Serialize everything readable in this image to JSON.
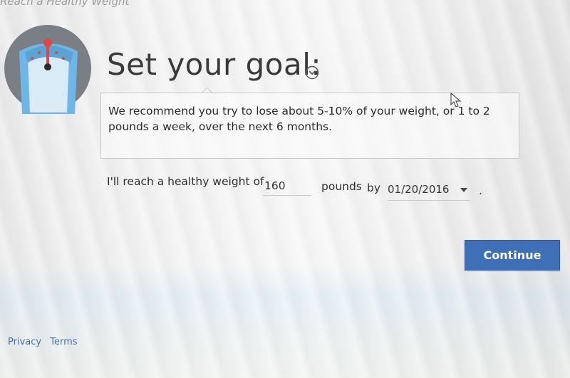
{
  "header": {
    "title": "Reach a Healthy Weight"
  },
  "logo": {
    "icon": "scale-icon",
    "colors": {
      "circle": "#7a7f86",
      "scale_body": "#6fb6e6",
      "scale_face": "#d9ebf6",
      "needle": "#e04646"
    }
  },
  "goal": {
    "title": "Set your goal:",
    "toggle_icon": "chevron-down-circle-icon",
    "recommendation": "We recommend you try to lose about 5-10% of your weight, or 1 to 2 pounds a week, over the next 6 months."
  },
  "form": {
    "label_reach": "I'll reach a healthy weight of",
    "weight_value": "160",
    "label_pounds": "pounds",
    "label_by": "by",
    "date_value": "01/20/2016",
    "period": "."
  },
  "actions": {
    "continue_label": "Continue",
    "continue_color": "#3f6fb7"
  },
  "footer": {
    "privacy_label": "Privacy",
    "terms_label": "Terms"
  }
}
